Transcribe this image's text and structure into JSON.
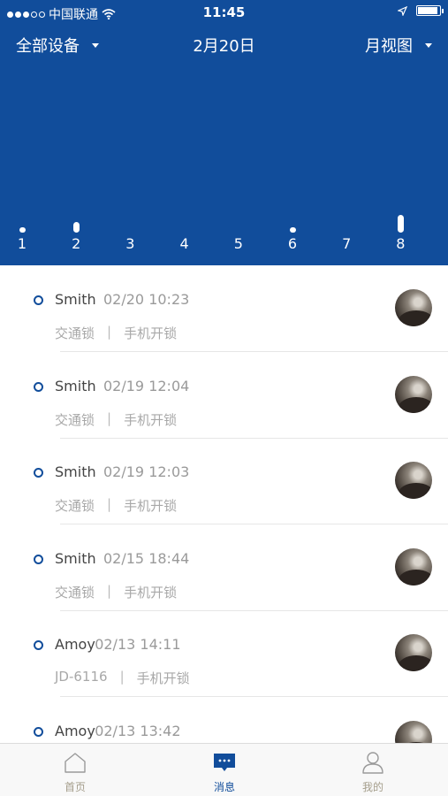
{
  "status_bar": {
    "carrier": "中国联通",
    "time": "11:45"
  },
  "nav": {
    "left_label": "全部设备",
    "center_label": "2月20日",
    "right_label": "月视图"
  },
  "days": [
    "1",
    "2",
    "3",
    "4",
    "5",
    "6",
    "7",
    "8"
  ],
  "activity": {
    "note": "white marks above day numbers",
    "levels": [
      1,
      2,
      0,
      0,
      0,
      1,
      0,
      3
    ]
  },
  "list": {
    "items": [
      {
        "name": "Smith",
        "time": "02/20 10:23",
        "lock": "交通锁",
        "sep": "|",
        "method": "手机开锁"
      },
      {
        "name": "Smith",
        "time": "02/19 12:04",
        "lock": "交通锁",
        "sep": "|",
        "method": "手机开锁"
      },
      {
        "name": "Smith",
        "time": "02/19 12:03",
        "lock": "交通锁",
        "sep": "|",
        "method": "手机开锁"
      },
      {
        "name": "Smith",
        "time": "02/15 18:44",
        "lock": "交通锁",
        "sep": "|",
        "method": "手机开锁"
      },
      {
        "name": "Amoy",
        "time": "02/13 14:11",
        "lock": "JD-6116",
        "sep": "|",
        "method": "手机开锁"
      },
      {
        "name": "Amoy",
        "time": "02/13 13:42",
        "lock": "",
        "sep": "",
        "method": ""
      }
    ]
  },
  "tabs": [
    {
      "label": "首页",
      "icon": "home-icon",
      "active": false
    },
    {
      "label": "消息",
      "icon": "message-icon",
      "active": true
    },
    {
      "label": "我的",
      "icon": "user-icon",
      "active": false
    }
  ],
  "colors": {
    "brand_blue": "#114d9b",
    "tab_inactive": "#a59e8c"
  }
}
